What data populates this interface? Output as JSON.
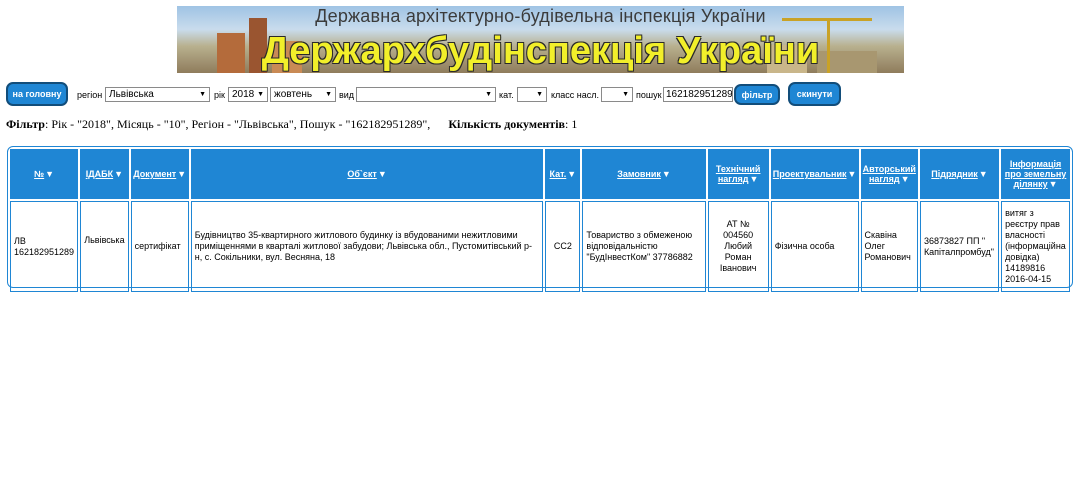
{
  "banner": {
    "subtitle": "Державна архітектурно-будівельна інспекція України",
    "title": "Держархбудінспекція України"
  },
  "toolbar": {
    "home_label": "на головну",
    "region_label": "регіон",
    "region_value": "Львівська",
    "year_label": "рік",
    "year_value": "2018",
    "month_value": "жовтень",
    "type_label": "вид",
    "type_value": "",
    "cat_label": "кат.",
    "cat_value": "",
    "class_label": "класс насл.",
    "class_value": "",
    "search_label": "пошук",
    "search_value": "162182951289",
    "filter_label": "фільтр",
    "reset_label": "скинути"
  },
  "filter": {
    "label": "Фільтр",
    "text": ": Рік - \"2018\", Місяць - \"10\", Регіон - \"Львівська\", Пошук - \"162182951289\",",
    "count_label": "Кількість документів",
    "count_value": ": 1"
  },
  "table": {
    "headers": {
      "num": "№",
      "idabk": "ІДАБК",
      "doc": "Документ",
      "object": "Об`єкт",
      "cat": "Кат.",
      "customer": "Замовник",
      "tech_1": "Технічний",
      "tech_2": "нагляд",
      "designer": "Проектувальник",
      "author_1": "Авторський",
      "author_2": "нагляд",
      "contractor": "Підрядник",
      "land_1": "Інформація",
      "land_2": "про земельну",
      "land_3": "ділянку"
    },
    "row": {
      "num_1": "ЛВ",
      "num_2": "162182951289",
      "idabk": "Львівська",
      "doc": "сертифікат",
      "object": "Будівництво 35-квартирного житлового будинку із вбудованими нежитловими приміщеннями в кварталі житлової забудови; Львівська обл., Пустомитівський р-н, с. Сокільники, вул. Весняна, 18",
      "cat": "СС2",
      "customer": "Товариство з обмеженою відповідальністю \"БудІнвестКом\" 37786882",
      "tech": "АТ № 004560 Любий Роман Іванович",
      "designer": "Фізична особа",
      "author": "Скавіна Олег Романович",
      "contractor": "36873827 ПП \" Капіталпромбуд\"",
      "land": "витяг з реєстру прав власності (інформаційна довідка) 14189816 2016-04-15"
    }
  },
  "colors": {
    "accent": "#1f86d4",
    "banner_title": "#f2ef2a"
  },
  "icons": {
    "sort": "sort-down-icon",
    "dropdown": "chevron-down-icon"
  }
}
